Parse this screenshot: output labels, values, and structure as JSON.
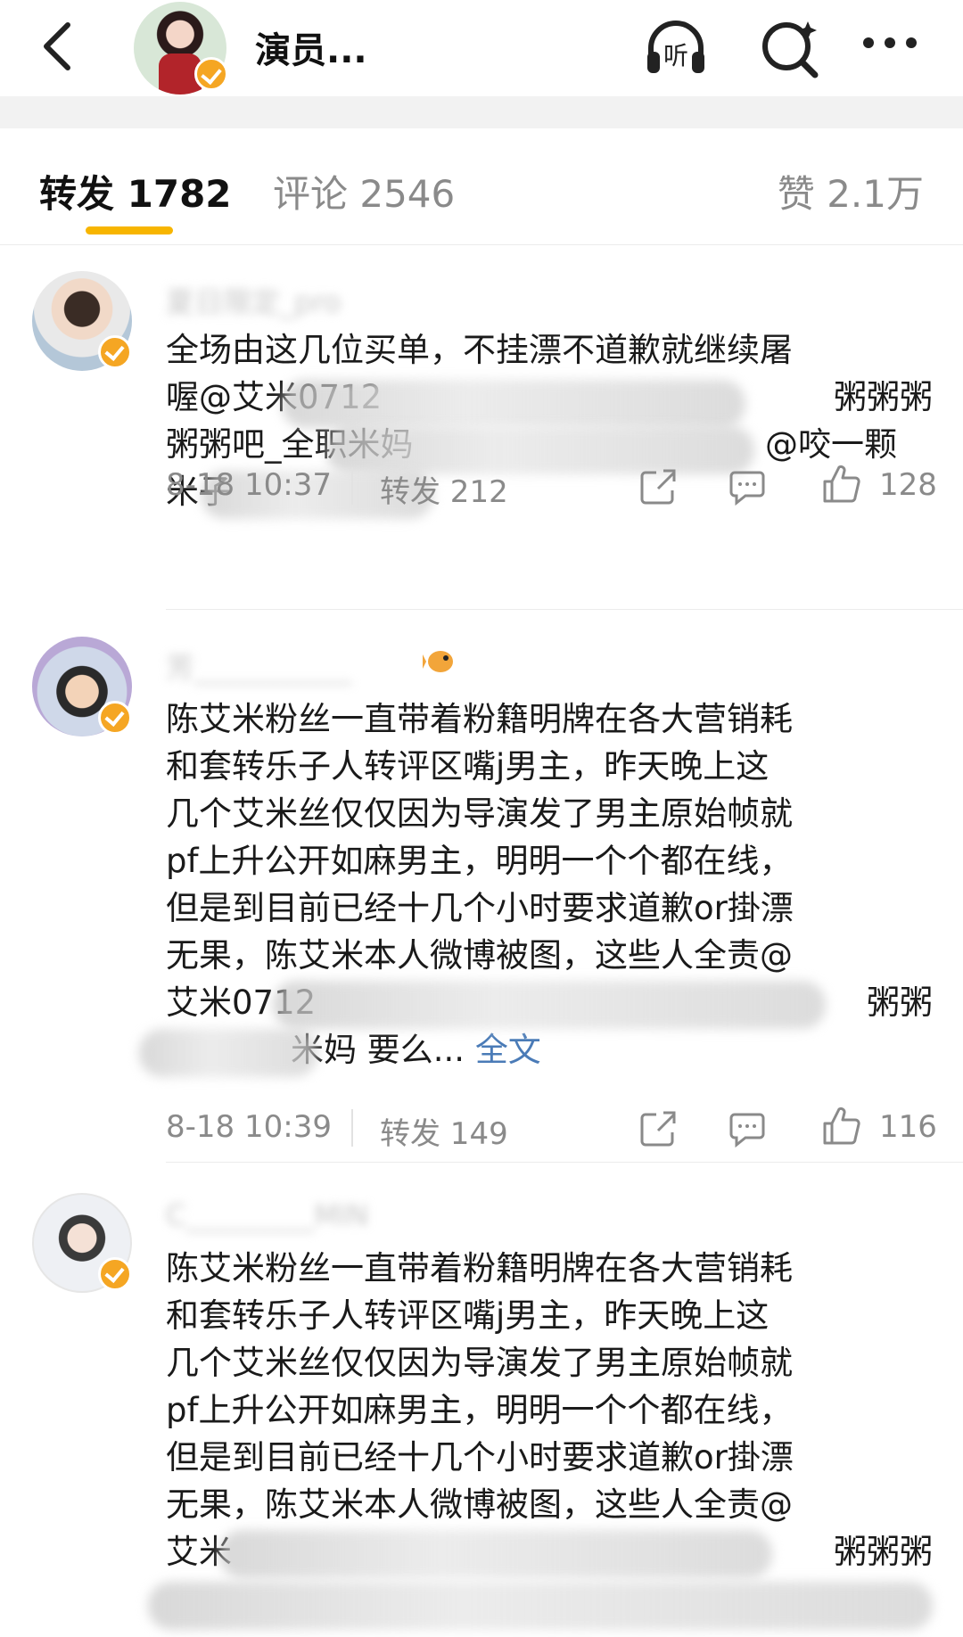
{
  "header": {
    "title": "演员...",
    "back_icon": "chevron-left-icon",
    "listen_label": "听",
    "search_icon": "search-icon",
    "more_icon": "more-dots-icon"
  },
  "tabs": {
    "repost": "转发 1782",
    "comments": "评论 2546",
    "likes": "赞 2.1万"
  },
  "posts": [
    {
      "text_visible_1": "全场由这几位买单，不挂漂不道歉就继续屠",
      "text_visible_2_start": "喔@艾米0712",
      "text_visible_2_end": "粥粥粥",
      "text_visible_3_start": "粥粥吧_全职米妈",
      "text_visible_3_end": "@咬一颗",
      "text_visible_4_start": "米子",
      "time": "8-18 10:37",
      "repost": "转发 212",
      "likes": "128"
    },
    {
      "lines": [
        "陈艾米粉丝一直带着粉籍明牌在各大营销耗",
        "和套转乐子人转评区嘴j男主，昨天晚上这",
        "几个艾米丝仅仅因为导演发了男主原始帧就",
        "pf上升公开如麻男主，明明一个个都在线，",
        "但是到目前已经十几个小时要求道歉or掛漂",
        "无果，陈艾米本人微博被图，这些人全责@"
      ],
      "line_7_start": "艾米0712",
      "line_7_end": "粥粥",
      "line_8": "米妈 要么...",
      "full_text": "全文",
      "time": "8-18 10:39",
      "repost": "转发 149",
      "likes": "116"
    },
    {
      "lines": [
        "陈艾米粉丝一直带着粉籍明牌在各大营销耗",
        "和套转乐子人转评区嘴j男主，昨天晚上这",
        "几个艾米丝仅仅因为导演发了男主原始帧就",
        "pf上升公开如麻男主，明明一个个都在线，",
        "但是到目前已经十几个小时要求道歉or掛漂",
        "无果，陈艾米本人微博被图，这些人全责@"
      ],
      "line_7_start": "艾米",
      "line_7_end": "粥粥粥"
    }
  ],
  "colors": {
    "accent": "#f7b500",
    "verified": "#f5a623",
    "link": "#4a7bb7"
  }
}
